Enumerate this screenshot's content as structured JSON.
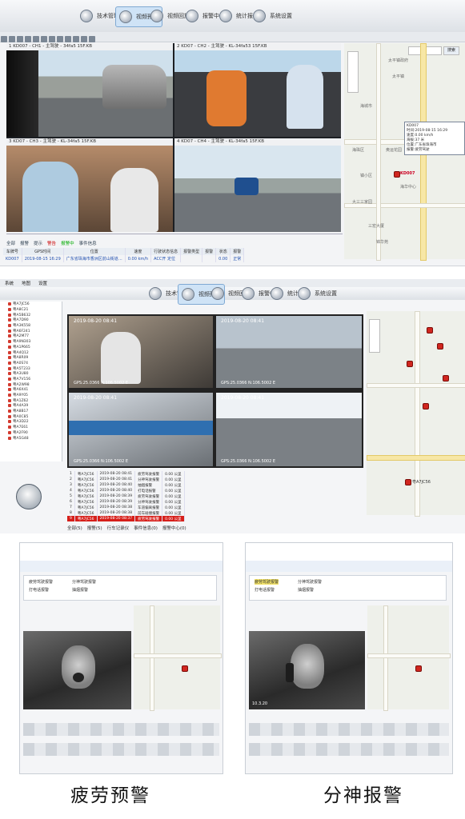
{
  "top": {
    "nav": [
      {
        "label": "技术管理",
        "active": false
      },
      {
        "label": "视频预览",
        "active": true
      },
      {
        "label": "视频回放",
        "active": false
      },
      {
        "label": "报警中心",
        "active": false
      },
      {
        "label": "统计报表",
        "active": false
      },
      {
        "label": "系统设置",
        "active": false
      }
    ],
    "videos": [
      {
        "num": "1",
        "title": "KD007 - CH1 - 主驾驶 - 34fa5 15F.KB"
      },
      {
        "num": "2",
        "title": "KD07 - CH2 - 主驾驶 - KL-34fa53 15F.KB"
      },
      {
        "num": "3",
        "title": "KD07 - CH3 - 主驾驶 - KL-34fa5 15F.KB"
      },
      {
        "num": "4",
        "title": "KD07 - CH4 - 主驾驶 - KL-34fa5 15F.KB"
      }
    ],
    "map": {
      "search_button": "搜索",
      "labels": [
        "太平镇政府",
        "太平镇",
        "海城市",
        "海珠区",
        "奥运花园",
        "镇小区",
        "海华中心",
        "大三三家园",
        "三宏大厦",
        "锦华苑"
      ],
      "popup_lines": [
        "KD007",
        "时间:2019-08-15 16:29",
        "速度:0.00 km/h",
        "海拔:37 米",
        "位置:广东省珠海市",
        "报警:疲劳驾驶"
      ],
      "vehicle_label": "KD007"
    },
    "tabs": [
      "全部",
      "报警",
      "提示",
      "警告",
      "报警中",
      "事件信息"
    ],
    "table_headers": [
      "车牌号",
      "GPS时间",
      "位置",
      "速度",
      "行驶状态信息",
      "报警类型",
      "报警",
      "状态",
      "报警"
    ],
    "table_row": [
      "KD007",
      "2019-08-15 16:29",
      "广东省珠海市香洲区前山街道…",
      "0.00 km/h",
      "ACC开 定位",
      "",
      "",
      "0.00",
      "正常"
    ]
  },
  "middle": {
    "menu": [
      "系统",
      "地图",
      "设置"
    ],
    "nav": [
      {
        "label": "技术管理",
        "active": false
      },
      {
        "label": "视频预览",
        "active": true
      },
      {
        "label": "视频回放",
        "active": false
      },
      {
        "label": "报警中心",
        "active": false
      },
      {
        "label": "统计报表",
        "active": false
      },
      {
        "label": "系统设置",
        "active": false
      }
    ],
    "tree_items": [
      "粤A7JC56",
      "粤A8C21",
      "粤A5B632",
      "粤A7D90",
      "粤A3K558",
      "粤A6F241",
      "粤A2M77",
      "粤A9N303",
      "粤A1P665",
      "粤A4Q12",
      "粤A8R09",
      "粤A0S74",
      "粤A5T233",
      "粤A3U80",
      "粤A7V156",
      "粤A2W98",
      "粤A6X41",
      "粤A9Y05",
      "粤A1Z62",
      "粤A4A39",
      "粤A8B17",
      "粤A0C85",
      "粤A3D22",
      "粤A7E61",
      "粤A2F90",
      "粤A5G48"
    ],
    "video_stamps": [
      "2019-08-20 08:41",
      "2019-08-20 08:41",
      "2019-08-20 08:41",
      "2019-08-20 08:41"
    ],
    "gps_stamps": [
      "GPS:25.0366 N:106.5002 E",
      "GPS:25.0366 N:106.5002 E",
      "GPS:25.0366 N:106.5002 E",
      "GPS:25.0366 N:106.5002 E"
    ],
    "alarm_rows": [
      [
        "1",
        "粤A7JC56",
        "2019-08-20 08:41",
        "疲劳驾驶报警",
        "0.00 公里"
      ],
      [
        "2",
        "粤A7JC56",
        "2019-08-20 08:41",
        "分神驾驶报警",
        "0.00 公里"
      ],
      [
        "3",
        "粤A7JC56",
        "2019-08-20 08:40",
        "抽烟报警",
        "0.00 公里"
      ],
      [
        "4",
        "粤A7JC56",
        "2019-08-20 08:40",
        "打电话报警",
        "0.00 公里"
      ],
      [
        "5",
        "粤A7JC56",
        "2019-08-20 08:39",
        "疲劳驾驶报警",
        "0.00 公里"
      ],
      [
        "6",
        "粤A7JC56",
        "2019-08-20 08:39",
        "分神驾驶报警",
        "0.00 公里"
      ],
      [
        "7",
        "粤A7JC56",
        "2019-08-20 08:38",
        "车道偏离报警",
        "0.00 公里"
      ],
      [
        "8",
        "粤A7JC56",
        "2019-08-20 08:38",
        "前车碰撞报警",
        "0.00 公里"
      ],
      [
        "9",
        "粤A7JC56",
        "2019-08-20 08:37",
        "疲劳驾驶报警",
        "0.00 公里"
      ]
    ],
    "map_label": "粤A7JC56",
    "status_tabs": [
      "全部(5)",
      "报警(5)",
      "行车记录仪",
      "事件信息(0)",
      "报警中心(0)"
    ]
  },
  "bottom": {
    "left_caption": "疲劳预警",
    "right_caption": "分神报警",
    "menu_items": [
      "疲劳驾驶报警",
      "分神驾驶报警",
      "打电话报警",
      "抽烟报警"
    ],
    "video_label": "10.3.20"
  }
}
